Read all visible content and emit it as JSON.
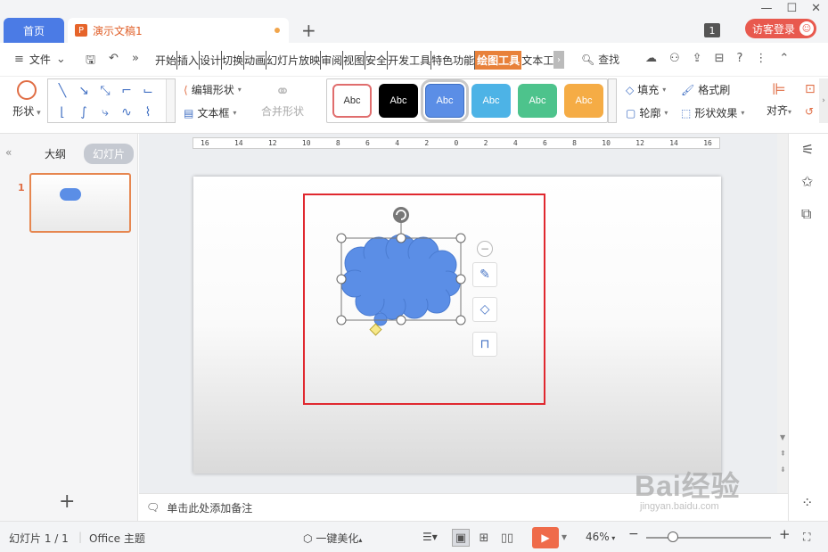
{
  "tabs": {
    "home": "首页",
    "document": "演示文稿1"
  },
  "title_bar": {
    "badge": "1",
    "login": "访客登录"
  },
  "menu": {
    "file": "文件",
    "tabs": [
      "开始",
      "插入",
      "设计",
      "切换",
      "动画",
      "幻灯片放映",
      "审阅",
      "视图",
      "安全",
      "开发工具",
      "特色功能",
      "绘图工具",
      "文本工"
    ],
    "active_tab": "绘图工具",
    "search": "查找"
  },
  "ribbon": {
    "shape": "形状",
    "edit_shape": "编辑形状",
    "text_box": "文本框",
    "merge_shape": "合并形状",
    "style_samples": [
      "Abc",
      "Abc",
      "Abc",
      "Abc",
      "Abc",
      "Abc"
    ],
    "fill": "填充",
    "format_painter": "格式刷",
    "outline": "轮廓",
    "shape_effect": "形状效果",
    "align": "对齐"
  },
  "left_panel": {
    "outline_tab": "大纲",
    "slides_tab": "幻灯片",
    "slide_number": "1"
  },
  "ruler": [
    "16",
    "14",
    "12",
    "10",
    "8",
    "6",
    "4",
    "2",
    "0",
    "2",
    "4",
    "6",
    "8",
    "10",
    "12",
    "14",
    "16"
  ],
  "notes": {
    "placeholder": "单击此处添加备注"
  },
  "status_bar": {
    "slide_info": "幻灯片 1 / 1",
    "theme": "Office 主题",
    "beautify": "一键美化",
    "zoom": "46%"
  },
  "watermark": {
    "brand": "Bai经验",
    "url": "jingyan.baidu.com"
  },
  "colors": {
    "accent_orange": "#e8813a",
    "cloud_fill": "#5b8ee6",
    "highlight_red": "#e0282f",
    "home_tab": "#4b7be5",
    "login_red": "#e8594e"
  }
}
